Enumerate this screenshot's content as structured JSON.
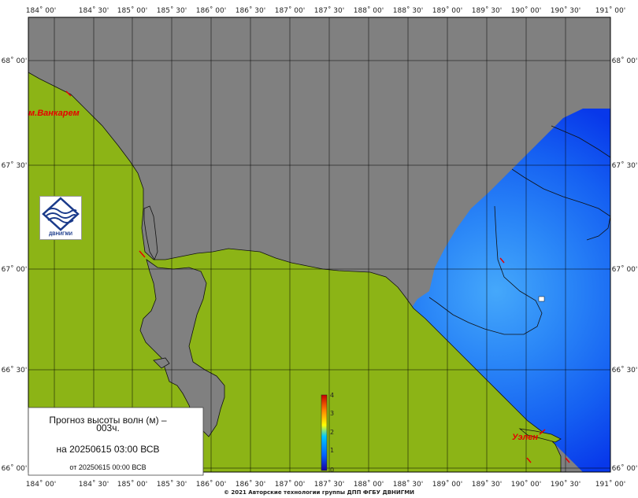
{
  "top_axis_labels": [
    "184˚ 00'",
    "184˚ 30'",
    "185˚ 00'",
    "185˚ 30'",
    "186˚ 00'",
    "186˚ 30'",
    "187˚ 00'",
    "187˚ 30'",
    "188˚ 00'",
    "188˚ 30'",
    "189˚ 00'",
    "189˚ 30'",
    "190˚ 00'",
    "190˚ 30'",
    "191˚ 00'"
  ],
  "bottom_axis_labels": [
    "184˚ 00'",
    "184˚ 30'",
    "185˚ 00'",
    "185˚ 30'",
    "186˚ 00'",
    "186˚ 30'",
    "187˚ 00'",
    "187˚ 30'",
    "188˚ 00'",
    "188˚ 30'",
    "189˚ 00'",
    "189˚ 30'",
    "190˚ 00'",
    "190˚ 30'",
    "191˚ 00'"
  ],
  "left_axis_labels": [
    "68˚ 00'",
    "67˚ 30'",
    "67˚ 00'",
    "66˚ 30'",
    "66˚ 00'"
  ],
  "right_axis_labels": [
    "68˚ 00'",
    "67˚ 30'",
    "67˚ 00'",
    "66˚ 30'",
    "66˚ 00'"
  ],
  "places": {
    "vankarem": "м.Ванкарем",
    "uelen": "Уэлен"
  },
  "logo": {
    "text": "ДВНИГМИ",
    "color": "#1a3a8a"
  },
  "colorbar": {
    "ticks": [
      "0",
      "1",
      "2",
      "3",
      "4"
    ],
    "colors": [
      "#1a00a0",
      "#0060ff",
      "#00c8ff",
      "#ffff00",
      "#ff8000",
      "#c80000"
    ]
  },
  "title_box": {
    "line1": "Прогноз высоты волн (м) –",
    "line2": "003ч.",
    "line3": "на 20250615 03:00 ВСВ",
    "line4": "от 20250615 00:00 ВСВ"
  },
  "copyright": "© 2021 Авторские технологии группы ДПП ФГБУ ДВНИГМИ",
  "colors": {
    "land": "#8cb416",
    "no_data": "#808080",
    "sea_deep": "#0a3cf0",
    "sea_mid": "#1f6ff5",
    "sea_light": "#3a9af8"
  }
}
